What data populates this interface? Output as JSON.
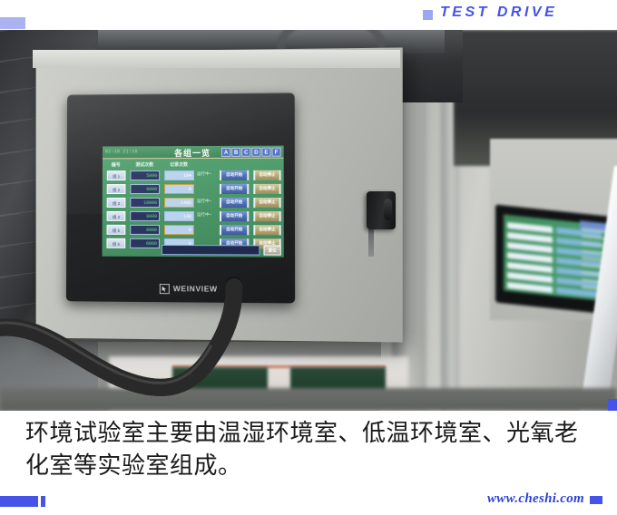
{
  "banner": {
    "title": "TEST DRIVE",
    "bullet_icon": "square-bullet-icon",
    "accent_color": "#4553e8"
  },
  "photo": {
    "subject": "industrial-control-enclosure-with-hmi-touch-panel",
    "device_brand": "WEINVIEW",
    "device_brand_icon": "weinview-logo-icon"
  },
  "hmi_screen": {
    "datetime": "02-10   21:18",
    "title": "各组一览",
    "group_buttons": [
      "A",
      "B",
      "C",
      "D",
      "E",
      "F"
    ],
    "columns": {
      "id": "编号",
      "test_count": "测试次数",
      "record_count": "记录次数"
    },
    "rows": [
      {
        "id": "组 1",
        "test_count": "5000",
        "record_count": "164",
        "status": "运行中~",
        "highlight": false,
        "start_label": "自动开始",
        "stop_label": "自动停止"
      },
      {
        "id": "组 2",
        "test_count": "9000",
        "record_count": "0",
        "status": "",
        "highlight": true,
        "start_label": "自动开始",
        "stop_label": "自动停止"
      },
      {
        "id": "组 3",
        "test_count": "10000",
        "record_count": "1486",
        "status": "运行中~",
        "highlight": true,
        "start_label": "自动开始",
        "stop_label": "自动停止"
      },
      {
        "id": "组 4",
        "test_count": "9000",
        "record_count": "148",
        "status": "运行中~",
        "highlight": false,
        "start_label": "自动开始",
        "stop_label": "自动停止"
      },
      {
        "id": "组 5",
        "test_count": "8000",
        "record_count": "0",
        "status": "",
        "highlight": true,
        "start_label": "自动开始",
        "stop_label": "自动停止"
      },
      {
        "id": "组 6",
        "test_count": "8000",
        "record_count": "0",
        "status": "",
        "highlight": false,
        "start_label": "自动开始",
        "stop_label": "自动停止"
      }
    ],
    "footer": {
      "input_value": "",
      "reset_label": "复位"
    }
  },
  "caption": {
    "text": "环境试验室主要由温湿环境室、低温环境室、光氧老化室等实验室组成。"
  },
  "watermark": {
    "text": "www.cheshi.com"
  }
}
